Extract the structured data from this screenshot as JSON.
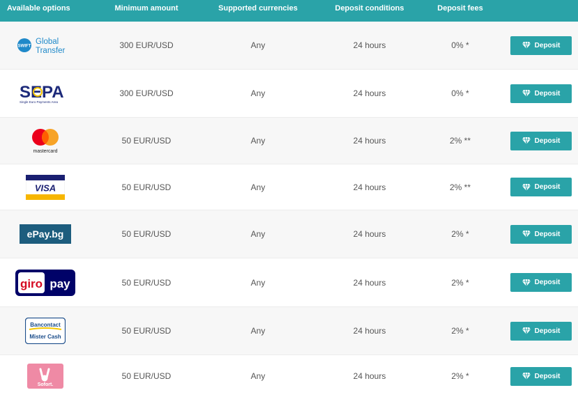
{
  "header": {
    "options": "Available options",
    "min_amount": "Minimum amount",
    "currencies": "Supported currencies",
    "conditions": "Deposit conditions",
    "fees": "Deposit fees"
  },
  "rows": [
    {
      "logo": "global-transfer",
      "logo_text1": "Global",
      "logo_text2": "Transfer",
      "logo_badge": "SWIFT",
      "min": "300 EUR/USD",
      "currencies": "Any",
      "conditions": "24 hours",
      "fee": "0% *",
      "button": "Deposit"
    },
    {
      "logo": "sepa",
      "logo_text1": "SEPA",
      "logo_text2": "Single Euro Payments Area",
      "min": "300 EUR/USD",
      "currencies": "Any",
      "conditions": "24 hours",
      "fee": "0% *",
      "button": "Deposit"
    },
    {
      "logo": "mastercard",
      "logo_text1": "mastercard",
      "min": "50 EUR/USD",
      "currencies": "Any",
      "conditions": "24 hours",
      "fee": "2% **",
      "button": "Deposit"
    },
    {
      "logo": "visa",
      "logo_text1": "VISA",
      "min": "50 EUR/USD",
      "currencies": "Any",
      "conditions": "24 hours",
      "fee": "2% **",
      "button": "Deposit"
    },
    {
      "logo": "epay",
      "logo_text1": "ePay.bg",
      "min": "50 EUR/USD",
      "currencies": "Any",
      "conditions": "24 hours",
      "fee": "2% *",
      "button": "Deposit"
    },
    {
      "logo": "giropay",
      "logo_text1": "giro",
      "logo_text2": "pay",
      "min": "50 EUR/USD",
      "currencies": "Any",
      "conditions": "24 hours",
      "fee": "2% *",
      "button": "Deposit"
    },
    {
      "logo": "bancontact",
      "logo_text1": "Bancontact",
      "logo_text2": "Mister Cash",
      "min": "50 EUR/USD",
      "currencies": "Any",
      "conditions": "24 hours",
      "fee": "2% *",
      "button": "Deposit"
    },
    {
      "logo": "sofort",
      "logo_text1": "Sofort.",
      "min": "50 EUR/USD",
      "currencies": "Any",
      "conditions": "24 hours",
      "fee": "2% *",
      "button": "Deposit"
    }
  ],
  "colors": {
    "accent": "#2aa3a8",
    "row_alt": "#f7f7f7",
    "text": "#555555"
  },
  "icons": {
    "deposit_button_icon": "diamond-icon"
  }
}
